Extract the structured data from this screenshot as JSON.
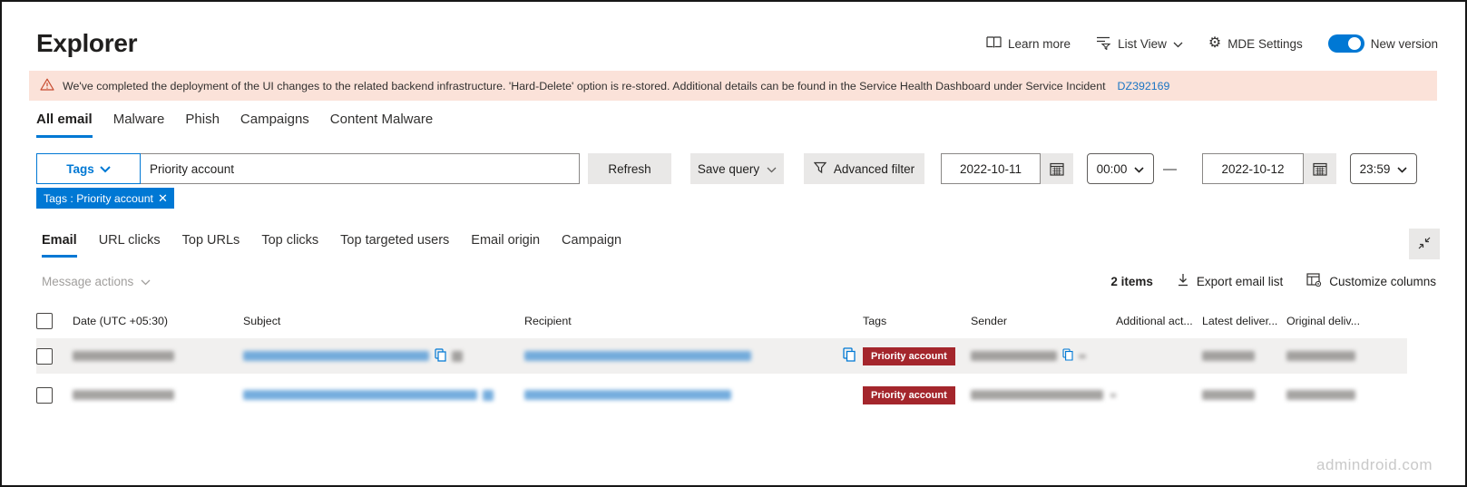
{
  "header": {
    "title": "Explorer",
    "learn_more": "Learn more",
    "list_view": "List View",
    "mde_settings": "MDE Settings",
    "new_version": "New version"
  },
  "banner": {
    "message": "We've completed the deployment of the UI changes to the related backend infrastructure. 'Hard-Delete' option is re-stored. Additional details can be found in the Service Health Dashboard under Service Incident",
    "link": "DZ392169"
  },
  "main_tabs": [
    "All email",
    "Malware",
    "Phish",
    "Campaigns",
    "Content Malware"
  ],
  "filters": {
    "tags_button": "Tags",
    "search_value": "Priority account",
    "refresh": "Refresh",
    "save_query": "Save query",
    "advanced_filter": "Advanced filter",
    "start_date": "2022-10-11",
    "start_time": "00:00",
    "end_date": "2022-10-12",
    "end_time": "23:59",
    "chip": "Tags : Priority account"
  },
  "view_tabs": [
    "Email",
    "URL clicks",
    "Top URLs",
    "Top clicks",
    "Top targeted users",
    "Email origin",
    "Campaign"
  ],
  "toolbar": {
    "message_actions": "Message actions",
    "items_count": "2 items",
    "export": "Export email list",
    "customize": "Customize columns"
  },
  "table": {
    "columns": [
      "Date (UTC +05:30)",
      "Subject",
      "Recipient",
      "Tags",
      "Sender",
      "Additional act...",
      "Latest deliver...",
      "Original deliv..."
    ],
    "rows": [
      {
        "tag_badge": "Priority account"
      },
      {
        "tag_badge": "Priority account"
      }
    ]
  },
  "watermark": "admindroid.com",
  "colors": {
    "accent": "#0078d4",
    "badge_red": "#a4262c",
    "banner_bg": "#fbe2d9"
  }
}
